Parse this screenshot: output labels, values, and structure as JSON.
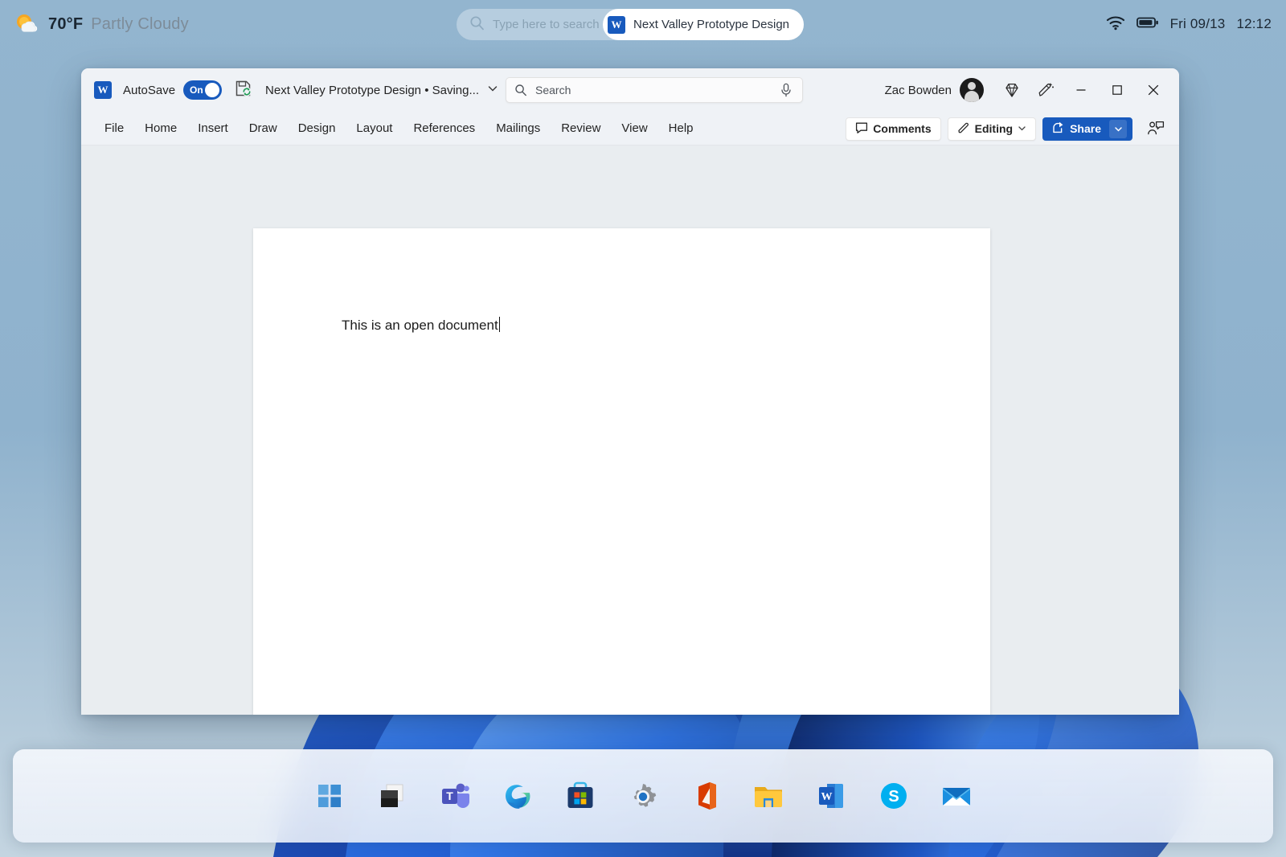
{
  "desktop": {
    "weather": {
      "icon": "partly-cloudy-icon",
      "temperature": "70°F",
      "condition": "Partly Cloudy"
    },
    "search": {
      "icon": "search-icon",
      "placeholder": "Type here to search",
      "pinned_task": {
        "icon": "word-app-icon",
        "label": "Next Valley Prototype Design"
      }
    },
    "systray": {
      "wifi_icon": "wifi-icon",
      "battery_icon": "battery-icon",
      "date": "Fri 09/13",
      "time": "12:12"
    },
    "taskbar": {
      "items": [
        {
          "name": "start-button",
          "label": "Start"
        },
        {
          "name": "task-view-button",
          "label": "Task View"
        },
        {
          "name": "teams-button",
          "label": "Microsoft Teams"
        },
        {
          "name": "edge-button",
          "label": "Microsoft Edge"
        },
        {
          "name": "store-button",
          "label": "Microsoft Store"
        },
        {
          "name": "settings-button",
          "label": "Settings"
        },
        {
          "name": "office-button",
          "label": "Office"
        },
        {
          "name": "file-explorer-button",
          "label": "File Explorer"
        },
        {
          "name": "word-button",
          "label": "Word"
        },
        {
          "name": "skype-button",
          "label": "Skype"
        },
        {
          "name": "mail-button",
          "label": "Mail"
        }
      ]
    }
  },
  "word": {
    "titlebar": {
      "app_icon": "word-app-icon",
      "autosave_label": "AutoSave",
      "autosave_state": "On",
      "save_icon": "save-sync-icon",
      "document_title": "Next Valley Prototype Design • Saving...",
      "title_chevron": "chevron-down-icon",
      "search_icon": "search-icon",
      "search_placeholder": "Search",
      "mic_icon": "microphone-icon",
      "user_name": "Zac Bowden",
      "avatar": "user-avatar",
      "diamond_icon": "diamond-icon",
      "designer_icon": "pen-sparkle-icon",
      "minimize_icon": "minimize-icon",
      "maximize_icon": "maximize-icon",
      "close_icon": "close-icon"
    },
    "ribbon": {
      "tabs": [
        "File",
        "Home",
        "Insert",
        "Draw",
        "Design",
        "Layout",
        "References",
        "Mailings",
        "Review",
        "View",
        "Help"
      ],
      "comments_label": "Comments",
      "comments_icon": "comment-bubble-icon",
      "editing_label": "Editing",
      "editing_icon": "pencil-icon",
      "editing_chevron": "chevron-down-icon",
      "share_label": "Share",
      "share_icon": "share-icon",
      "share_chevron": "chevron-down-icon",
      "catchup_icon": "person-mention-icon"
    },
    "document": {
      "body_text": "This is an open document"
    }
  },
  "colors": {
    "word_blue": "#185abd",
    "accent_share": "#185abd",
    "desktop_blue": "#8fb2cd",
    "titlebar_gray": "#eff2f6",
    "canvas_gray": "#e9edf0"
  }
}
